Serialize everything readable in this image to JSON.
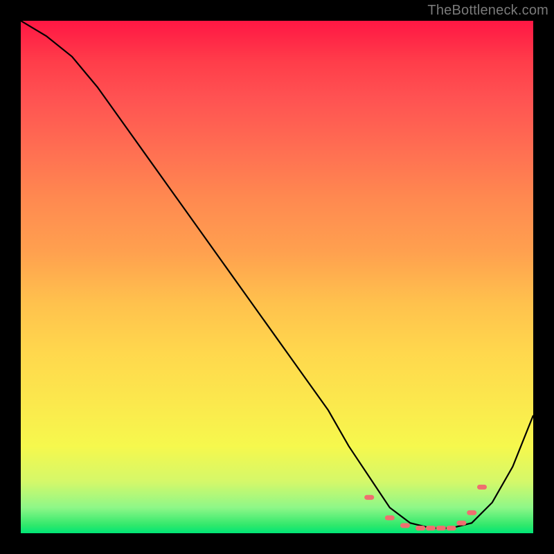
{
  "watermark": "TheBottleneck.com",
  "chart_data": {
    "type": "line",
    "title": "",
    "xlabel": "",
    "ylabel": "",
    "xlim": [
      0,
      100
    ],
    "ylim": [
      0,
      100
    ],
    "series": [
      {
        "name": "bottleneck-curve",
        "x": [
          0,
          5,
          10,
          15,
          20,
          25,
          30,
          35,
          40,
          45,
          50,
          55,
          60,
          64,
          68,
          72,
          76,
          80,
          84,
          88,
          92,
          96,
          100
        ],
        "values": [
          100,
          97,
          93,
          87,
          80,
          73,
          66,
          59,
          52,
          45,
          38,
          31,
          24,
          17,
          11,
          5,
          2,
          1,
          1,
          2,
          6,
          13,
          23
        ]
      }
    ],
    "markers": {
      "name": "highlighted-range",
      "x": [
        68,
        72,
        75,
        78,
        80,
        82,
        84,
        86,
        88,
        90
      ],
      "values": [
        7,
        3,
        1.5,
        1,
        1,
        1,
        1,
        2,
        4,
        9
      ]
    },
    "background_gradient_stops": [
      {
        "pos": 0.0,
        "color": "#ff1744"
      },
      {
        "pos": 0.5,
        "color": "#ffb84d"
      },
      {
        "pos": 0.85,
        "color": "#f6f84d"
      },
      {
        "pos": 1.0,
        "color": "#00e676"
      }
    ]
  }
}
